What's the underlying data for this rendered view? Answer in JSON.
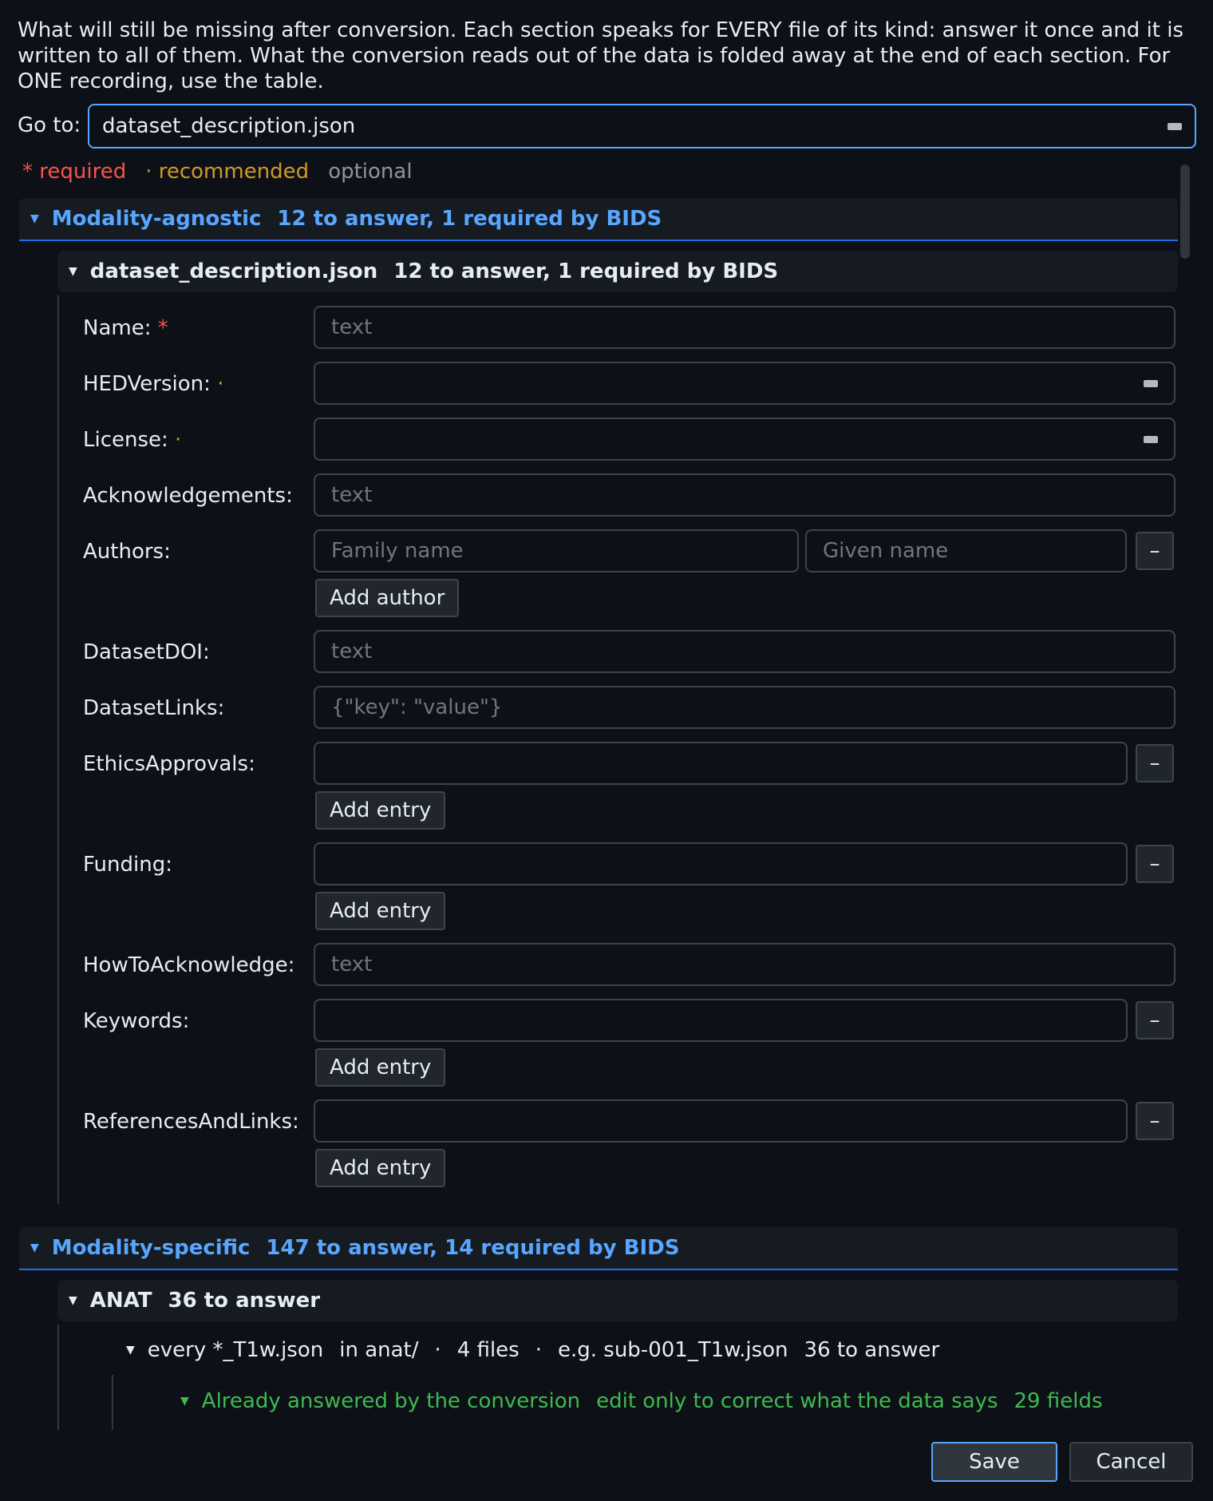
{
  "intro_text": "What will still be missing after conversion. Each section speaks for EVERY file of its kind: answer it once and it is written to all of them. What the conversion reads out of the data is folded away at the end of each section. For ONE recording, use the table.",
  "goto": {
    "label": "Go to:",
    "value": "dataset_description.json"
  },
  "legend": {
    "required": "* required",
    "recommended": "· recommended",
    "optional": "optional"
  },
  "agnostic": {
    "title": "Modality-agnostic",
    "summary": "12 to answer, 1 required by BIDS",
    "file": {
      "name": "dataset_description.json",
      "summary": "12 to answer, 1 required by BIDS"
    },
    "fields": {
      "name": {
        "label": "Name:",
        "marker": "*",
        "placeholder": "text"
      },
      "hed": {
        "label": "HEDVersion:",
        "marker": "·"
      },
      "license": {
        "label": "License:",
        "marker": "·"
      },
      "ack": {
        "label": "Acknowledgements:",
        "placeholder": "text"
      },
      "authors": {
        "label": "Authors:",
        "family_placeholder": "Family name",
        "given_placeholder": "Given name",
        "add": "Add author"
      },
      "doi": {
        "label": "DatasetDOI:",
        "placeholder": "text"
      },
      "links": {
        "label": "DatasetLinks:",
        "placeholder": "{\"key\": \"value\"}"
      },
      "ethics": {
        "label": "EthicsApprovals:",
        "add": "Add entry"
      },
      "funding": {
        "label": "Funding:",
        "add": "Add entry"
      },
      "howto": {
        "label": "HowToAcknowledge:",
        "placeholder": "text"
      },
      "keywords": {
        "label": "Keywords:",
        "add": "Add entry"
      },
      "refs": {
        "label": "ReferencesAndLinks:",
        "add": "Add entry"
      }
    },
    "remove_label": "–"
  },
  "specific": {
    "title": "Modality-specific",
    "summary": "147 to answer, 14 required by BIDS",
    "anat": {
      "name": "ANAT",
      "summary": "36 to answer"
    },
    "file_row": {
      "pattern": "every *_T1w.json",
      "location": "in anat/",
      "sep": "·",
      "count": "4 files",
      "example": "e.g. sub-001_T1w.json",
      "summary": "36 to answer"
    },
    "answered": {
      "title": "Already answered by the conversion",
      "note": "edit only to correct what the data says",
      "count": "29 fields"
    }
  },
  "footer": {
    "save": "Save",
    "cancel": "Cancel"
  },
  "colors": {
    "accent": "#58a6ff",
    "required": "#f85149",
    "recommended": "#d29922",
    "optional": "#8b949e",
    "answered": "#3fb950"
  }
}
